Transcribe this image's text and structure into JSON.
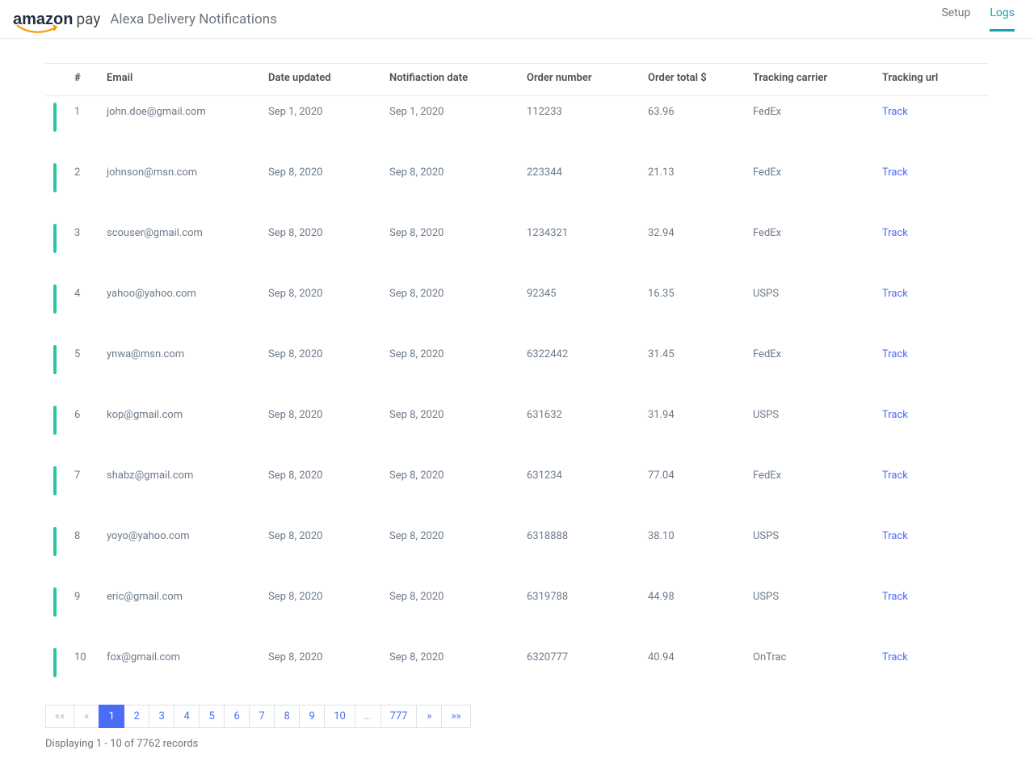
{
  "header": {
    "logo_main": "amazon",
    "logo_sub": "pay",
    "app_title": "Alexa Delivery Notifications",
    "nav": {
      "setup": "Setup",
      "logs": "Logs"
    }
  },
  "table": {
    "headers": {
      "idx": "#",
      "email": "Email",
      "date_updated": "Date updated",
      "notification_date": "Notifiaction date",
      "order_number": "Order number",
      "order_total": "Order total $",
      "carrier": "Tracking carrier",
      "tracking_url": "Tracking url"
    },
    "track_label": "Track",
    "rows": [
      {
        "idx": "1",
        "email": "john.doe@gmail.com",
        "date_updated": "Sep 1, 2020",
        "notification_date": "Sep 1, 2020",
        "order_number": "112233",
        "order_total": "63.96",
        "carrier": "FedEx"
      },
      {
        "idx": "2",
        "email": "johnson@msn.com",
        "date_updated": "Sep 8, 2020",
        "notification_date": "Sep 8, 2020",
        "order_number": "223344",
        "order_total": "21.13",
        "carrier": "FedEx"
      },
      {
        "idx": "3",
        "email": "scouser@gmail.com",
        "date_updated": "Sep 8, 2020",
        "notification_date": "Sep 8, 2020",
        "order_number": "1234321",
        "order_total": "32.94",
        "carrier": "FedEx"
      },
      {
        "idx": "4",
        "email": "yahoo@yahoo.com",
        "date_updated": "Sep 8, 2020",
        "notification_date": "Sep 8, 2020",
        "order_number": "92345",
        "order_total": "16.35",
        "carrier": "USPS"
      },
      {
        "idx": "5",
        "email": "ynwa@msn.com",
        "date_updated": "Sep 8, 2020",
        "notification_date": "Sep 8, 2020",
        "order_number": "6322442",
        "order_total": "31.45",
        "carrier": "FedEx"
      },
      {
        "idx": "6",
        "email": "kop@gmail.com",
        "date_updated": "Sep 8, 2020",
        "notification_date": "Sep 8, 2020",
        "order_number": "631632",
        "order_total": "31.94",
        "carrier": "USPS"
      },
      {
        "idx": "7",
        "email": "shabz@gmail.com",
        "date_updated": "Sep 8, 2020",
        "notification_date": "Sep 8, 2020",
        "order_number": "631234",
        "order_total": "77.04",
        "carrier": "FedEx"
      },
      {
        "idx": "8",
        "email": "yoyo@yahoo.com",
        "date_updated": "Sep 8, 2020",
        "notification_date": "Sep 8, 2020",
        "order_number": "6318888",
        "order_total": "38.10",
        "carrier": "USPS"
      },
      {
        "idx": "9",
        "email": "eric@gmail.com",
        "date_updated": "Sep 8, 2020",
        "notification_date": "Sep 8, 2020",
        "order_number": "6319788",
        "order_total": "44.98",
        "carrier": "USPS"
      },
      {
        "idx": "10",
        "email": "fox@gmail.com",
        "date_updated": "Sep 8, 2020",
        "notification_date": "Sep 8, 2020",
        "order_number": "6320777",
        "order_total": "40.94",
        "carrier": "OnTrac"
      }
    ]
  },
  "pagination": {
    "items": [
      {
        "label": "««",
        "state": "disabled"
      },
      {
        "label": "«",
        "state": "disabled"
      },
      {
        "label": "1",
        "state": "active"
      },
      {
        "label": "2",
        "state": ""
      },
      {
        "label": "3",
        "state": ""
      },
      {
        "label": "4",
        "state": ""
      },
      {
        "label": "5",
        "state": ""
      },
      {
        "label": "6",
        "state": ""
      },
      {
        "label": "7",
        "state": ""
      },
      {
        "label": "8",
        "state": ""
      },
      {
        "label": "9",
        "state": ""
      },
      {
        "label": "10",
        "state": ""
      },
      {
        "label": "…",
        "state": "disabled"
      },
      {
        "label": "777",
        "state": ""
      },
      {
        "label": "»",
        "state": ""
      },
      {
        "label": "»»",
        "state": ""
      }
    ],
    "records_text": "Displaying 1 - 10 of 7762 records"
  }
}
